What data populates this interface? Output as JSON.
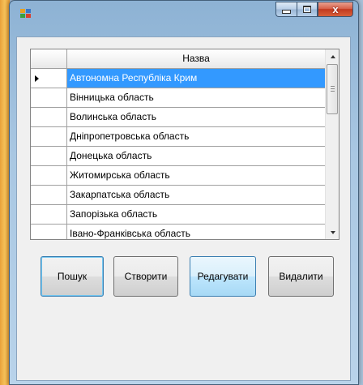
{
  "window": {
    "title": "",
    "caption_close_label": "x"
  },
  "grid": {
    "column_header": "Назва",
    "rows": [
      "Автономна Республіка Крим",
      "Вінницька область",
      "Волинська область",
      "Дніпропетровська область",
      "Донецька область",
      "Житомирська область",
      "Закарпатська область",
      "Запорізька область",
      "Івано-Франківська область"
    ],
    "selected_index": 0
  },
  "buttons": {
    "search": "Пошук",
    "create": "Створити",
    "edit": "Редагувати",
    "delete": "Видалити"
  },
  "colors": {
    "selection": "#3399ff",
    "close_button": "#c23a1f"
  }
}
